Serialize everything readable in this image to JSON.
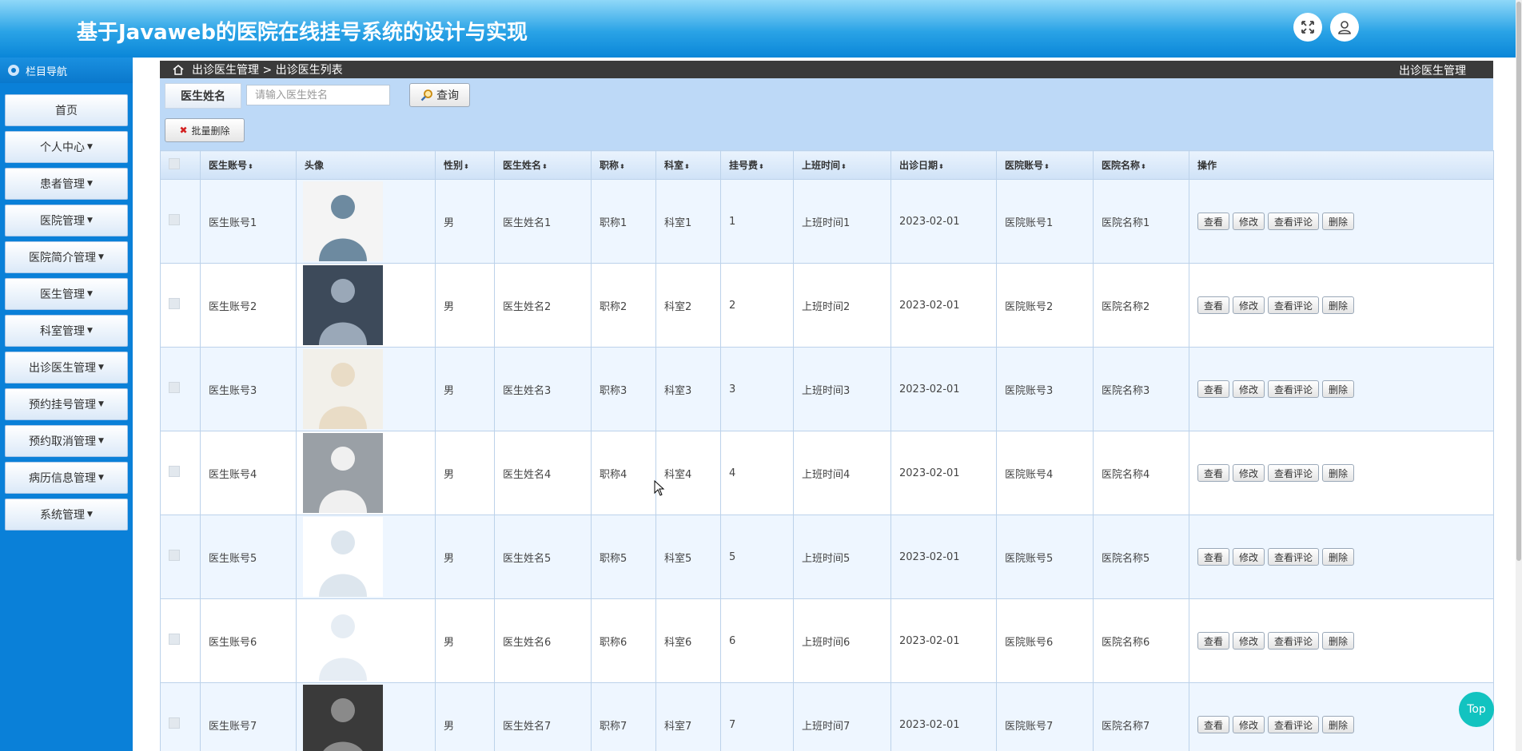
{
  "header": {
    "title": "基于Javaweb的医院在线挂号系统的设计与实现"
  },
  "sidebar": {
    "heading": "栏目导航",
    "items": [
      {
        "label": "首页",
        "caret": false
      },
      {
        "label": "个人中心",
        "caret": true
      },
      {
        "label": "患者管理",
        "caret": true
      },
      {
        "label": "医院管理",
        "caret": true
      },
      {
        "label": "医院简介管理",
        "caret": true
      },
      {
        "label": "医生管理",
        "caret": true
      },
      {
        "label": "科室管理",
        "caret": true
      },
      {
        "label": "出诊医生管理",
        "caret": true
      },
      {
        "label": "预约挂号管理",
        "caret": true
      },
      {
        "label": "预约取消管理",
        "caret": true
      },
      {
        "label": "病历信息管理",
        "caret": true
      },
      {
        "label": "系统管理",
        "caret": true
      }
    ]
  },
  "breadcrumb": {
    "path": "出诊医生管理 > 出诊医生列表",
    "right": "出诊医生管理"
  },
  "search": {
    "label": "医生姓名",
    "placeholder": "请输入医生姓名",
    "button": "查询",
    "batch_delete": "批量删除"
  },
  "table": {
    "columns": [
      "医生账号",
      "头像",
      "性别",
      "医生姓名",
      "职称",
      "科室",
      "挂号费",
      "上班时间",
      "出诊日期",
      "医院账号",
      "医院名称",
      "操作"
    ],
    "actions": [
      "查看",
      "修改",
      "查看评论",
      "删除"
    ],
    "rows": [
      {
        "account": "医生账号1",
        "gender": "男",
        "name": "医生姓名1",
        "title": "职称1",
        "dept": "科室1",
        "fee": "1",
        "worktime": "上班时间1",
        "date": "2023-02-01",
        "hospital_account": "医院账号1",
        "hospital_name": "医院名称1"
      },
      {
        "account": "医生账号2",
        "gender": "男",
        "name": "医生姓名2",
        "title": "职称2",
        "dept": "科室2",
        "fee": "2",
        "worktime": "上班时间2",
        "date": "2023-02-01",
        "hospital_account": "医院账号2",
        "hospital_name": "医院名称2"
      },
      {
        "account": "医生账号3",
        "gender": "男",
        "name": "医生姓名3",
        "title": "职称3",
        "dept": "科室3",
        "fee": "3",
        "worktime": "上班时间3",
        "date": "2023-02-01",
        "hospital_account": "医院账号3",
        "hospital_name": "医院名称3"
      },
      {
        "account": "医生账号4",
        "gender": "男",
        "name": "医生姓名4",
        "title": "职称4",
        "dept": "科室4",
        "fee": "4",
        "worktime": "上班时间4",
        "date": "2023-02-01",
        "hospital_account": "医院账号4",
        "hospital_name": "医院名称4"
      },
      {
        "account": "医生账号5",
        "gender": "男",
        "name": "医生姓名5",
        "title": "职称5",
        "dept": "科室5",
        "fee": "5",
        "worktime": "上班时间5",
        "date": "2023-02-01",
        "hospital_account": "医院账号5",
        "hospital_name": "医院名称5"
      },
      {
        "account": "医生账号6",
        "gender": "男",
        "name": "医生姓名6",
        "title": "职称6",
        "dept": "科室6",
        "fee": "6",
        "worktime": "上班时间6",
        "date": "2023-02-01",
        "hospital_account": "医院账号6",
        "hospital_name": "医院名称6"
      },
      {
        "account": "医生账号7",
        "gender": "男",
        "name": "医生姓名7",
        "title": "职称7",
        "dept": "科室7",
        "fee": "7",
        "worktime": "上班时间7",
        "date": "2023-02-01",
        "hospital_account": "医院账号7",
        "hospital_name": "医院名称7"
      }
    ]
  },
  "top_button": "Top",
  "colors": {
    "header": "#2aa3e6",
    "sidebar": "#0a80d8",
    "search_bar": "#bdd9f7",
    "top_button": "#12c3c0",
    "delete_x": "#d32020"
  },
  "icons": [
    "fullscreen-icon",
    "user-icon",
    "home-icon",
    "search-icon",
    "close-icon",
    "sort-icon"
  ]
}
